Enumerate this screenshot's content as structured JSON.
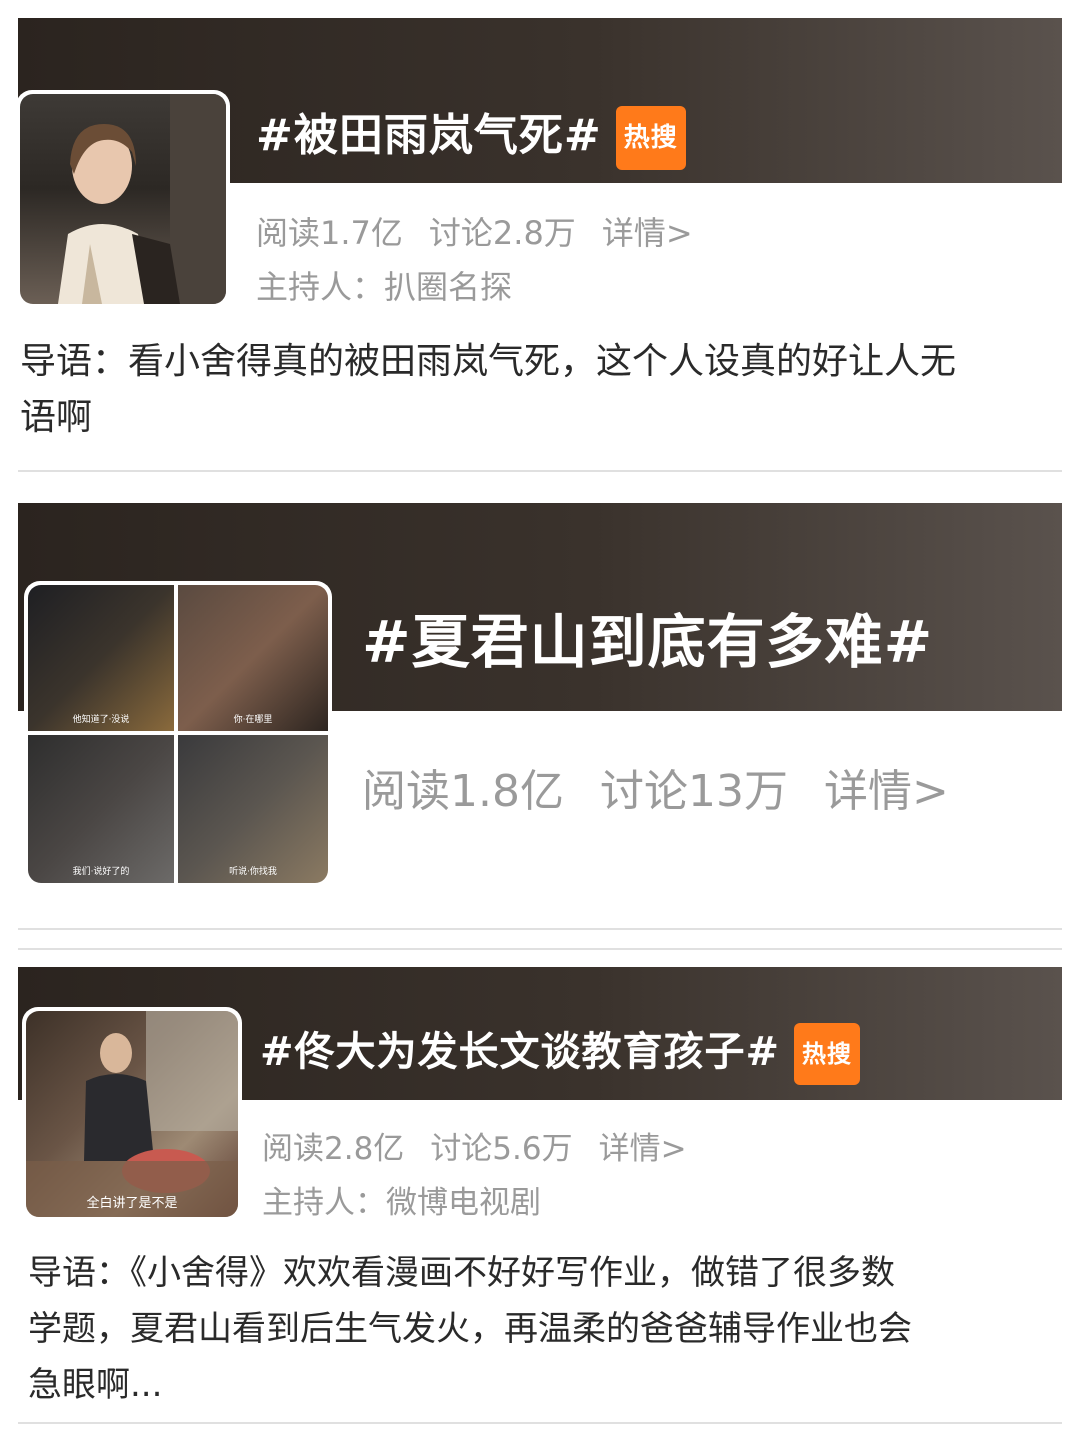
{
  "topics": [
    {
      "title": "#被田雨岚气死#",
      "badge": "热搜",
      "reads": "阅读1.7亿",
      "discussions": "讨论2.8万",
      "details": "详情>",
      "host": "主持人：扒圈名探",
      "intro_line1": "导语：看小舍得真的被田雨岚气死，这个人设真的好让人无",
      "intro_line2": "语啊"
    },
    {
      "title": "#夏君山到底有多难#",
      "reads": "阅读1.8亿",
      "discussions": "讨论13万",
      "details": "详情>"
    },
    {
      "title": "#佟大为发长文谈教育孩子#",
      "badge": "热搜",
      "reads": "阅读2.8亿",
      "discussions": "讨论5.6万",
      "details": "详情>",
      "host": "主持人：微博电视剧",
      "intro_line1": "导语：《小舍得》欢欢看漫画不好好写作业，做错了很多数",
      "intro_line2": "学题，夏君山看到后生气发火，再温柔的爸爸辅导作业也会",
      "intro_line3": "急眼啊..."
    }
  ],
  "thumb2_captions": [
    "他知道了·没说",
    "你·在哪里",
    "我们·说好了的",
    "听说·你找我"
  ],
  "thumb3_caption": "全白讲了是不是",
  "colors": {
    "banner_dark": "#2b241f",
    "badge": "#ff7a1a",
    "meta_text": "#9a9a9a"
  }
}
